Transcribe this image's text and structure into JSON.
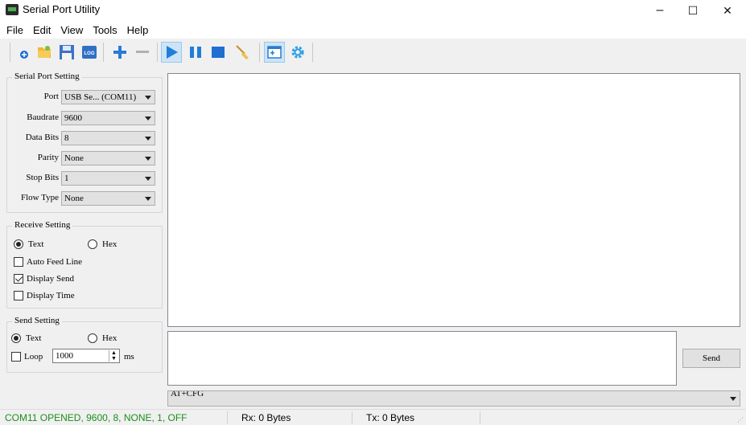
{
  "window": {
    "title": "Serial Port Utility",
    "minimize": "–",
    "maximize": "☐",
    "close": "✕"
  },
  "menu": [
    "File",
    "Edit",
    "View",
    "Tools",
    "Help"
  ],
  "toolbar": {
    "icons": [
      "new-connection-icon",
      "open-icon",
      "save-icon",
      "log-icon",
      "add-icon",
      "remove-icon",
      "play-icon",
      "pause-icon",
      "stop-icon",
      "clear-broom-icon",
      "layout-icon",
      "settings-gear-icon"
    ],
    "log_label": "LOG",
    "active": "play-icon"
  },
  "serial_port": {
    "title": "Serial Port Setting",
    "port_label": "Port",
    "port_value": "USB Se... (COM11)",
    "baud_label": "Baudrate",
    "baud_value": "9600",
    "databits_label": "Data Bits",
    "databits_value": "8",
    "parity_label": "Parity",
    "parity_value": "None",
    "stopbits_label": "Stop Bits",
    "stopbits_value": "1",
    "flow_label": "Flow Type",
    "flow_value": "None"
  },
  "receive": {
    "title": "Receive Setting",
    "text_label": "Text",
    "hex_label": "Hex",
    "auto_feed_label": "Auto Feed Line",
    "display_send_label": "Display Send",
    "display_time_label": "Display Time",
    "mode": "Text",
    "auto_feed": false,
    "display_send": true,
    "display_time": false
  },
  "send_setting": {
    "title": "Send Setting",
    "text_label": "Text",
    "hex_label": "Hex",
    "loop_label": "Loop",
    "loop_value": "1000",
    "ms_label": "ms",
    "mode": "Text",
    "loop": false
  },
  "send_button": "Send",
  "command_combo": "AT+CFG",
  "status": {
    "connection": "COM11 OPENED, 9600, 8, NONE, 1, OFF",
    "connection_color": "#1a8f1a",
    "rx": "Rx: 0 Bytes",
    "tx": "Tx: 0 Bytes"
  }
}
